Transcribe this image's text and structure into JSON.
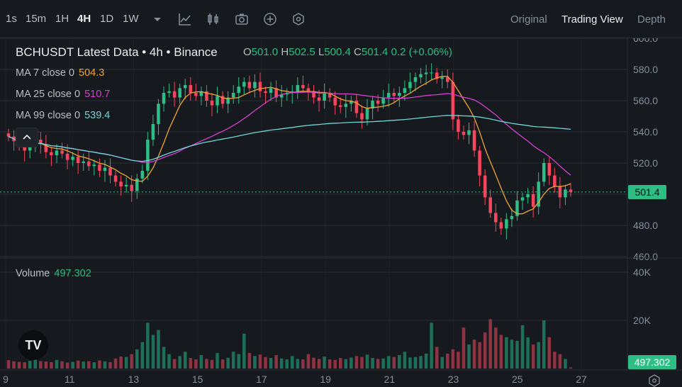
{
  "toolbar": {
    "timeframes": [
      {
        "label": "1s",
        "active": false
      },
      {
        "label": "15m",
        "active": false
      },
      {
        "label": "1H",
        "active": false
      },
      {
        "label": "4H",
        "active": true
      },
      {
        "label": "1D",
        "active": false
      },
      {
        "label": "1W",
        "active": false
      }
    ],
    "tools": [
      "chevron-down-icon",
      "indicator-chart-icon",
      "candles-icon",
      "camera-icon",
      "add-circle-icon",
      "settings-hex-icon"
    ],
    "views": [
      {
        "label": "Original",
        "active": false
      },
      {
        "label": "Trading View",
        "active": true
      },
      {
        "label": "Depth",
        "active": false
      }
    ]
  },
  "legend": {
    "title": "BCHUSDT Latest Data • 4h • Binance",
    "ohlc": {
      "o_label": "O",
      "o": "501.0",
      "h_label": "H",
      "h": "502.5",
      "l_label": "L",
      "l": "500.4",
      "c_label": "C",
      "c": "501.4",
      "change": "0.2",
      "change_pct": "(+0.06%)"
    }
  },
  "ma": [
    {
      "label": "MA 7 close 0",
      "value": "504.3",
      "color": "#f0a33b"
    },
    {
      "label": "MA 25 close 0",
      "value": "510.7",
      "color": "#d63fd0"
    },
    {
      "label": "MA 99 close 0",
      "value": "539.4",
      "color": "#6fd6d6"
    }
  ],
  "volume": {
    "label": "Volume",
    "value": "497.302"
  },
  "price_axis": [
    "600.0",
    "580.0",
    "560.0",
    "540.0",
    "520.0",
    "500.0",
    "480.0",
    "460.0"
  ],
  "volume_axis": [
    "40K",
    "20K"
  ],
  "last_price": "501.4",
  "last_volume": "497.302",
  "x_axis": [
    "9",
    "11",
    "13",
    "15",
    "17",
    "19",
    "21",
    "23",
    "25",
    "27"
  ],
  "colors": {
    "up": "#2ebd85",
    "down": "#f6465d",
    "background": "#161a1e",
    "grid": "#2b2f36"
  },
  "chart_data": {
    "type": "candlestick",
    "symbol": "BCHUSDT",
    "interval": "4h",
    "ylim": [
      460,
      600
    ],
    "volume_ylim": [
      0,
      40000
    ],
    "closes": [
      537,
      534,
      532,
      528,
      530,
      535,
      532,
      527,
      525,
      528,
      526,
      522,
      524,
      520,
      521,
      518,
      519,
      515,
      517,
      512,
      508,
      505,
      506,
      502,
      510,
      515,
      535,
      545,
      558,
      565,
      566,
      562,
      568,
      570,
      565,
      563,
      566,
      560,
      557,
      563,
      558,
      562,
      565,
      569,
      572,
      568,
      572,
      566,
      565,
      568,
      562,
      564,
      565,
      566,
      570,
      568,
      566,
      562,
      560,
      565,
      562,
      557,
      556,
      558,
      560,
      552,
      548,
      555,
      560,
      558,
      562,
      565,
      563,
      565,
      568,
      572,
      575,
      577,
      578,
      578,
      574,
      575,
      572,
      548,
      540,
      538,
      541,
      528,
      512,
      498,
      488,
      482,
      478,
      484,
      486,
      496,
      498,
      500,
      492,
      508,
      520,
      512,
      505,
      498,
      503,
      501.4
    ],
    "ma7": {
      "last": 504.3
    },
    "ma25": {
      "last": 510.7
    },
    "ma99": {
      "last": 539.4
    },
    "volumes": [
      3500,
      3000,
      2800,
      2600,
      3200,
      3800,
      3100,
      2900,
      2700,
      3600,
      3000,
      2500,
      2800,
      3300,
      2900,
      3100,
      2600,
      3400,
      3000,
      2700,
      4200,
      5000,
      4800,
      6000,
      8000,
      11000,
      19000,
      14000,
      16000,
      9000,
      6000,
      4000,
      5200,
      7000,
      4400,
      3800,
      5600,
      4000,
      3600,
      6400,
      3800,
      4500,
      7000,
      6000,
      14500,
      6500,
      5200,
      5800,
      4800,
      4400,
      5600,
      4200,
      3800,
      5200,
      4000,
      3800,
      6000,
      4500,
      4000,
      5000,
      3800,
      3600,
      4400,
      3900,
      4600,
      5200,
      4800,
      5800,
      4400,
      4000,
      4200,
      5200,
      4800,
      5600,
      7000,
      4600,
      4800,
      5200,
      6200,
      19000,
      9000,
      4800,
      6200,
      8000,
      7000,
      17000,
      10000,
      12000,
      11000,
      15000,
      20500,
      17000,
      14000,
      13000,
      12000,
      11500,
      18000,
      13000,
      10000,
      11000,
      20000,
      13000,
      7000,
      6000,
      4000,
      497
    ]
  }
}
